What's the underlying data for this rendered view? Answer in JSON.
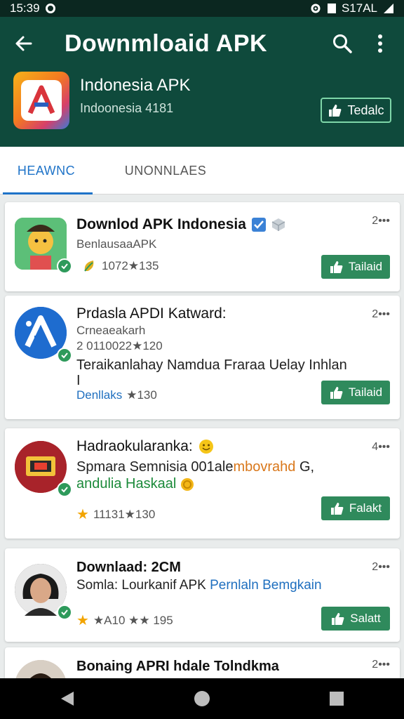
{
  "status_bar": {
    "time": "15:39",
    "right_text": "S17AL"
  },
  "header": {
    "title": "Downmloaid APK",
    "app_name": "Indonesia APK",
    "app_sub": "Indoonesia 4181",
    "like_label": "Tedalc",
    "accent": "#0f4a3c"
  },
  "tabs": [
    {
      "label": "HEAWNC"
    },
    {
      "label": "UNONNLAES"
    }
  ],
  "cards": [
    {
      "title": "Downlod APK Indonesia",
      "line1": "BenlausaaAPK",
      "rating_text": "1072★135",
      "count": "2•••",
      "button": "Tailaid"
    },
    {
      "title": "Prdasla APDI Katward:",
      "line1": "Crneaeakarh",
      "line2": "2 0110022★120",
      "text": "Teraikanlahay Namdua Fraraa Uelay Inhlan",
      "text2": "I",
      "link": "Denllaks",
      "rating_text": "★130",
      "count": "2•••",
      "button": "Tailaid"
    },
    {
      "title": "Hadraokularanka:",
      "text_a": "Spmara Semnisia 001ale",
      "text_b": "mbovrahd",
      "text_c": " G,",
      "text_d": "andulia Haskaal",
      "rating_text": "11131★130",
      "count": "4•••",
      "button": "Falakt"
    },
    {
      "title": "Downlaad: 2CM",
      "text_a": "Somla: Lourkanif APK ",
      "text_b": "Pernlaln Bemgkain",
      "rating_text": "★A10 ★★ 195",
      "count": "2•••",
      "button": "Salatt"
    },
    {
      "title": "Bonaing APRI hdale Tolndkma",
      "count": "2•••"
    }
  ]
}
